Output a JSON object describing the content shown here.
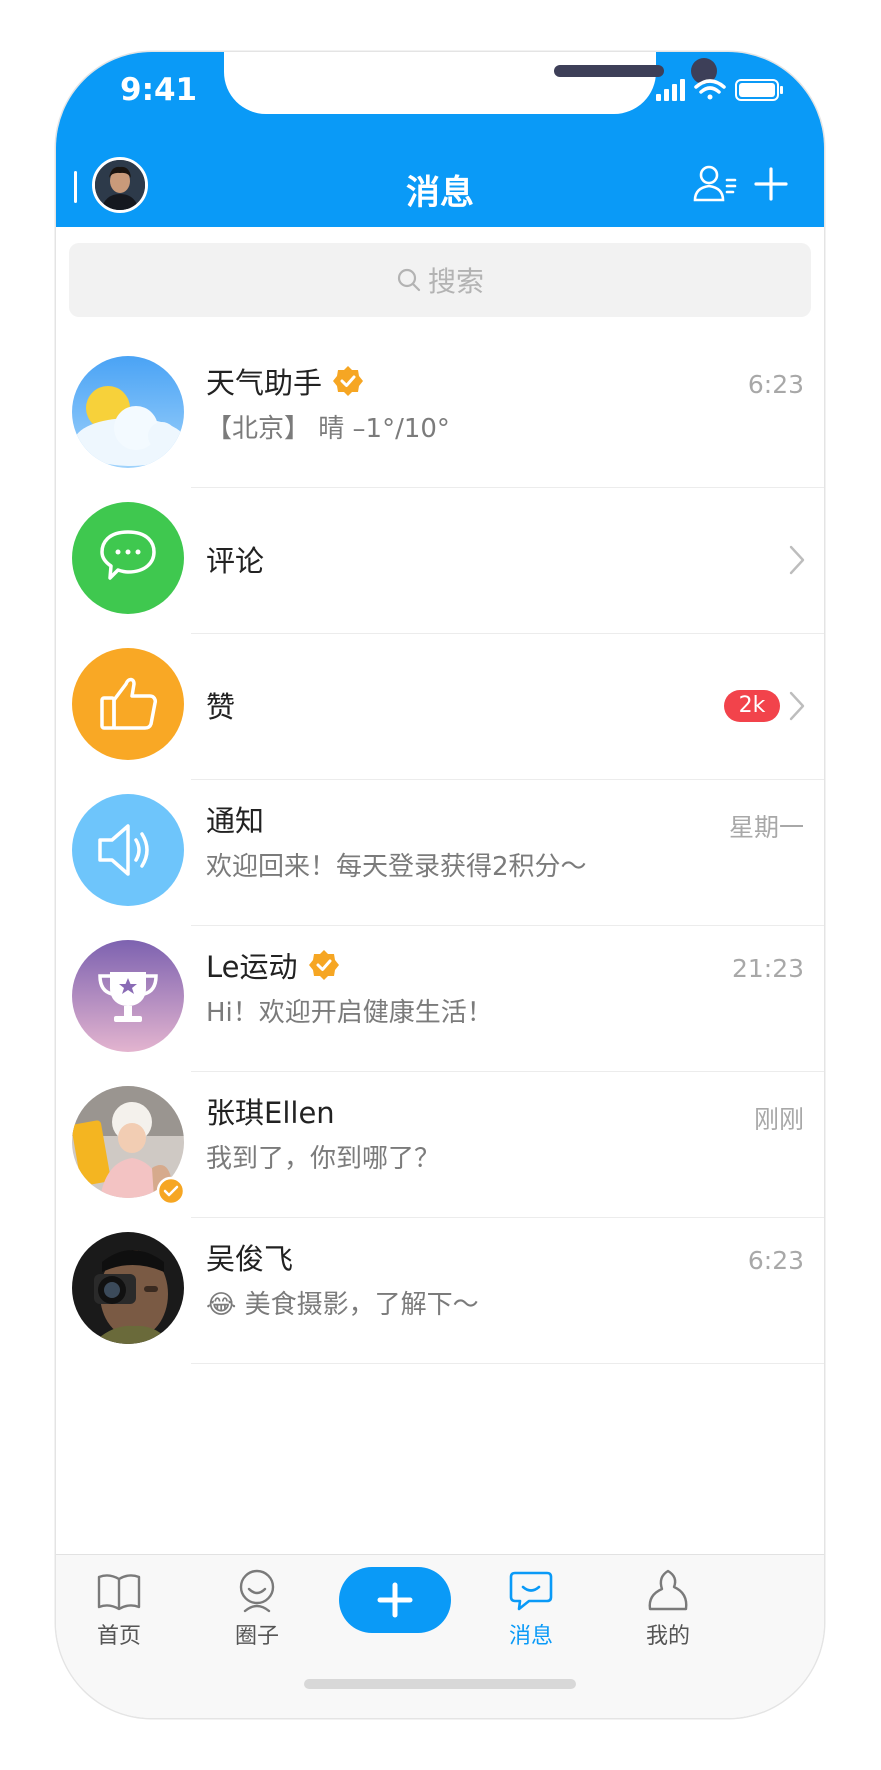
{
  "status_bar": {
    "time": "9:41"
  },
  "header": {
    "title": "消息"
  },
  "search": {
    "placeholder": "搜索"
  },
  "conversations": [
    {
      "name": "天气助手",
      "verified": true,
      "time": "6:23",
      "preview": "【北京】 晴 –1°/10°",
      "avatar": "weather-icon"
    },
    {
      "name": "评论",
      "avatar": "comment-icon",
      "chevron": true
    },
    {
      "name": "赞",
      "avatar": "thumbs-up-icon",
      "badge": "2k",
      "chevron": true
    },
    {
      "name": "通知",
      "time": "星期一",
      "preview": "欢迎回来！每天登录获得2积分～",
      "avatar": "speaker-icon"
    },
    {
      "name": "Le运动",
      "verified": true,
      "time": "21:23",
      "preview": "Hi！欢迎开启健康生活！",
      "avatar": "trophy-icon"
    },
    {
      "name": "张琪Ellen",
      "time": "刚刚",
      "preview": "我到了，你到哪了？",
      "avatar": "user-photo"
    },
    {
      "name": "吴俊飞",
      "time": "6:23",
      "preview": "美食摄影，了解下～",
      "avatar": "user-photo",
      "emoji": "😂"
    }
  ],
  "tabs": [
    {
      "label": "首页",
      "icon": "book-icon"
    },
    {
      "label": "圈子",
      "icon": "circle-face-icon"
    },
    {
      "label": "消息",
      "icon": "message-bubble-icon",
      "active": true
    },
    {
      "label": "我的",
      "icon": "profile-icon"
    }
  ],
  "colors": {
    "primary": "#0a9af7",
    "badge": "#f2434b",
    "verified": "#f6a623",
    "green": "#3fc84f",
    "orange": "#f9a825",
    "light_blue": "#6ec5fb",
    "purple": "#8a6bb5"
  }
}
